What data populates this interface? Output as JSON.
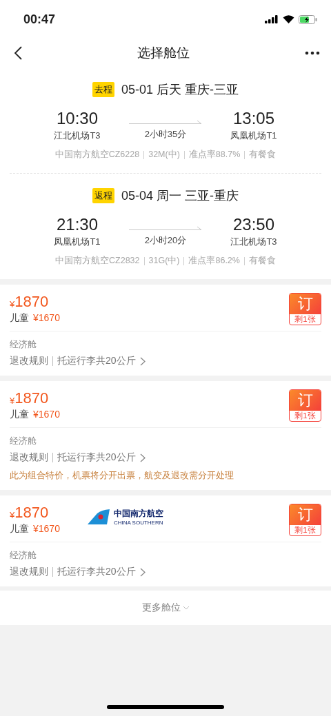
{
  "status_bar": {
    "time": "00:47"
  },
  "nav": {
    "title": "选择舱位"
  },
  "trips": [
    {
      "tag": "去程",
      "header": "05-01 后天 重庆-三亚",
      "depart_time": "10:30",
      "depart_airport": "江北机场T3",
      "duration": "2小时35分",
      "arrive_time": "13:05",
      "arrive_airport": "凤凰机场T1",
      "details": [
        "中国南方航空CZ6228",
        "32M(中)",
        "准点率88.7%",
        "有餐食"
      ]
    },
    {
      "tag": "返程",
      "header": "05-04 周一 三亚-重庆",
      "depart_time": "21:30",
      "depart_airport": "凤凰机场T1",
      "duration": "2小时20分",
      "arrive_time": "23:50",
      "arrive_airport": "江北机场T3",
      "details": [
        "中国南方航空CZ2832",
        "31G(中)",
        "准点率86.2%",
        "有餐食"
      ]
    }
  ],
  "fares": [
    {
      "currency": "¥",
      "price": "1870",
      "child_label": "儿童",
      "child_price": "¥1670",
      "cabin": "经济舱",
      "rules": "退改规则",
      "baggage": "托运行李共20公斤",
      "book": "订",
      "remaining": "剩1张"
    },
    {
      "currency": "¥",
      "price": "1870",
      "child_label": "儿童",
      "child_price": "¥1670",
      "cabin": "经济舱",
      "rules": "退改规则",
      "baggage": "托运行李共20公斤",
      "book": "订",
      "remaining": "剩1张",
      "notice": "此为组合特价，机票将分开出票，航变及退改需分开处理"
    },
    {
      "currency": "¥",
      "price": "1870",
      "child_label": "儿童",
      "child_price": "¥1670",
      "airline": {
        "name_cn": "中国南方航空",
        "name_en": "CHINA SOUTHERN"
      },
      "cabin": "经济舱",
      "rules": "退改规则",
      "baggage": "托运行李共20公斤",
      "book": "订",
      "remaining": "剩1张"
    }
  ],
  "more": {
    "label": "更多舱位"
  }
}
